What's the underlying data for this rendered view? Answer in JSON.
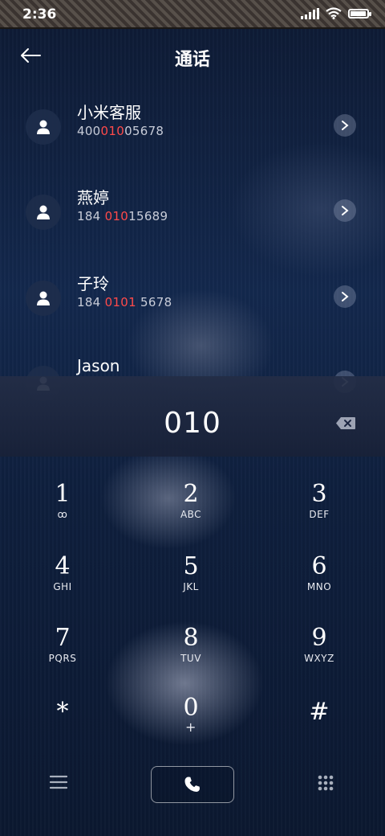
{
  "status": {
    "time": "2:36"
  },
  "header": {
    "title": "通话"
  },
  "contacts": [
    {
      "name": "小米客服",
      "num_pre": "400",
      "num_hl": "010",
      "num_post": "05678"
    },
    {
      "name": "燕婷",
      "num_pre": "184 ",
      "num_hl": "010",
      "num_post": "15689"
    },
    {
      "name": "子玲",
      "num_pre": "184 ",
      "num_hl": "0101",
      "num_post": " 5678"
    },
    {
      "name": "Jason"
    }
  ],
  "dialer": {
    "entry": "010"
  },
  "keys": [
    {
      "digit": "1",
      "letters": "ꝏ"
    },
    {
      "digit": "2",
      "letters": "ABC"
    },
    {
      "digit": "3",
      "letters": "DEF"
    },
    {
      "digit": "4",
      "letters": "GHI"
    },
    {
      "digit": "5",
      "letters": "JKL"
    },
    {
      "digit": "6",
      "letters": "MNO"
    },
    {
      "digit": "7",
      "letters": "PQRS"
    },
    {
      "digit": "8",
      "letters": "TUV"
    },
    {
      "digit": "9",
      "letters": "WXYZ"
    },
    {
      "digit": "*",
      "letters": ""
    },
    {
      "digit": "0",
      "letters": "+"
    },
    {
      "digit": "#",
      "letters": ""
    }
  ],
  "icons": {
    "back": "arrow-left-icon",
    "contact": "person-icon",
    "chevron": "chevron-right-icon",
    "delete": "backspace-icon",
    "voicemail": "voicemail-icon",
    "menu": "menu-icon",
    "call": "phone-icon",
    "keypad": "keypad-icon"
  },
  "colors": {
    "highlight": "#ff4a4a",
    "background": "#13284d"
  }
}
